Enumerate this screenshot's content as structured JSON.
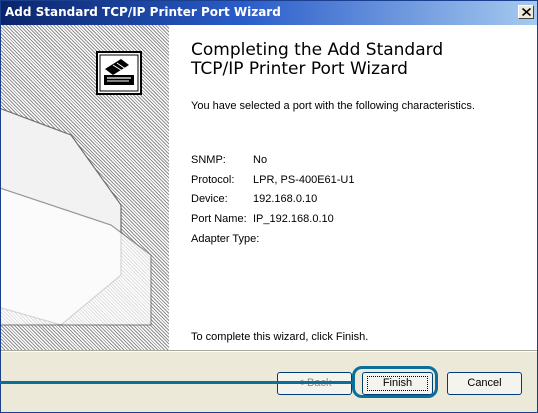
{
  "window": {
    "title": "Add Standard TCP/IP Printer Port Wizard"
  },
  "content": {
    "heading_line1": "Completing the Add Standard",
    "heading_line2": "TCP/IP Printer Port Wizard",
    "intro": "You have selected a port with the following characteristics.",
    "properties": [
      {
        "label": "SNMP:",
        "value": "No"
      },
      {
        "label": "Protocol:",
        "value": "LPR, PS-400E61-U1"
      },
      {
        "label": "Device:",
        "value": "192.168.0.10"
      },
      {
        "label": "Port Name:",
        "value": "IP_192.168.0.10"
      },
      {
        "label": "Adapter Type:",
        "value": ""
      }
    ],
    "footer": "To complete this wizard, click Finish."
  },
  "buttons": {
    "back": "< Back",
    "finish": "Finish",
    "cancel": "Cancel"
  },
  "colors": {
    "titlebar": "#0a246a",
    "highlight": "#0b6f9c"
  },
  "icons": {
    "sidebar": "printer-wizard-icon",
    "close": "close-icon"
  }
}
